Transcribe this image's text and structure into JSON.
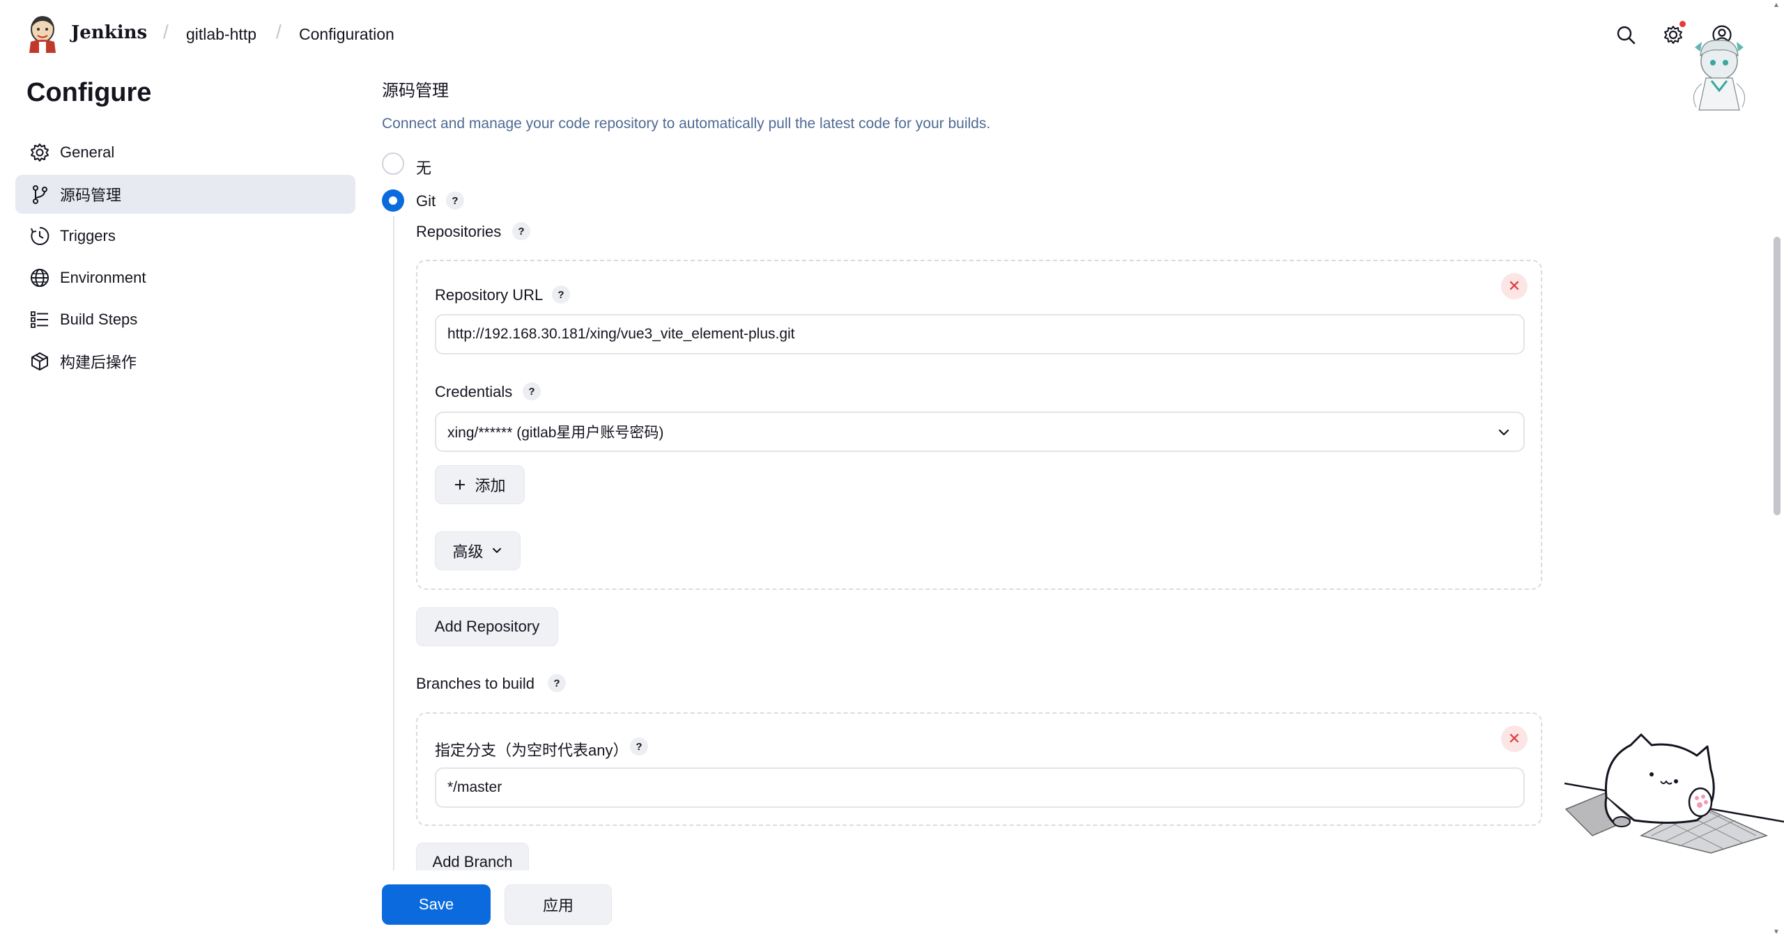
{
  "header": {
    "brand": "Jenkins",
    "breadcrumb": [
      "gitlab-http",
      "Configuration"
    ],
    "icons": [
      "search-icon",
      "gear-icon",
      "account-icon"
    ]
  },
  "sidebar": {
    "title": "Configure",
    "items": [
      {
        "label": "General",
        "icon": "gear-icon"
      },
      {
        "label": "源码管理",
        "icon": "branch-icon",
        "active": true
      },
      {
        "label": "Triggers",
        "icon": "clock-icon"
      },
      {
        "label": "Environment",
        "icon": "globe-icon"
      },
      {
        "label": "Build Steps",
        "icon": "list-icon"
      },
      {
        "label": "构建后操作",
        "icon": "package-icon"
      }
    ]
  },
  "main": {
    "section_title": "源码管理",
    "section_desc": "Connect and manage your code repository to automatically pull the latest code for your builds.",
    "options": {
      "none_label": "无",
      "git_label": "Git",
      "selected": "Git"
    },
    "repositories_label": "Repositories",
    "repo": {
      "url_label": "Repository URL",
      "url_value": "http://192.168.30.181/xing/vue3_vite_element-plus.git",
      "credentials_label": "Credentials",
      "credentials_value": "xing/****** (gitlab星用户账号密码)",
      "add_label": "添加",
      "advanced_label": "高级"
    },
    "add_repository_label": "Add Repository",
    "branches_label": "Branches to build",
    "branch": {
      "spec_label": "指定分支（为空时代表any）",
      "spec_value": "*/master"
    },
    "add_branch_label": "Add Branch",
    "help_glyph": "?",
    "remove_glyph": "✕"
  },
  "footer": {
    "save_label": "Save",
    "apply_label": "应用"
  },
  "colors": {
    "accent": "#0b6bde",
    "active_sidebar_bg": "#e7eaf1",
    "desc_text": "#4f6a93",
    "danger": "#e23838"
  }
}
